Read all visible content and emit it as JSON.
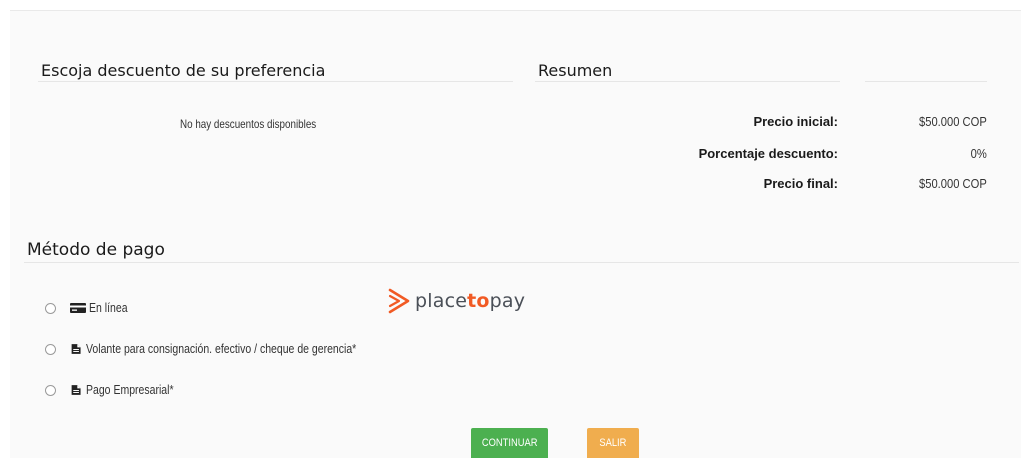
{
  "discounts": {
    "title": "Escoja descuento de su preferencia",
    "empty_message": "No hay descuentos disponibles"
  },
  "summary": {
    "title": "Resumen",
    "rows": [
      {
        "label": "Precio inicial:",
        "value": "$50.000 COP"
      },
      {
        "label": "Porcentaje descuento:",
        "value": "0%"
      },
      {
        "label": "Precio final:",
        "value": "$50.000 COP"
      }
    ]
  },
  "payment": {
    "title": "Método de pago",
    "options": [
      {
        "label": "En línea",
        "icon": "credit-card-icon"
      },
      {
        "label": "Volante para consignación. efectivo / cheque de gerencia*",
        "icon": "document-icon"
      },
      {
        "label": "Pago Empresarial*",
        "icon": "document-icon"
      }
    ],
    "provider_logo": {
      "prefix": "place",
      "accent": "to",
      "suffix": "pay",
      "accent_color": "#f15a24"
    }
  },
  "actions": {
    "continue_label": "CONTINUAR",
    "exit_label": "SALIR",
    "continue_color": "#4cb050",
    "exit_color": "#f0ad4e"
  }
}
